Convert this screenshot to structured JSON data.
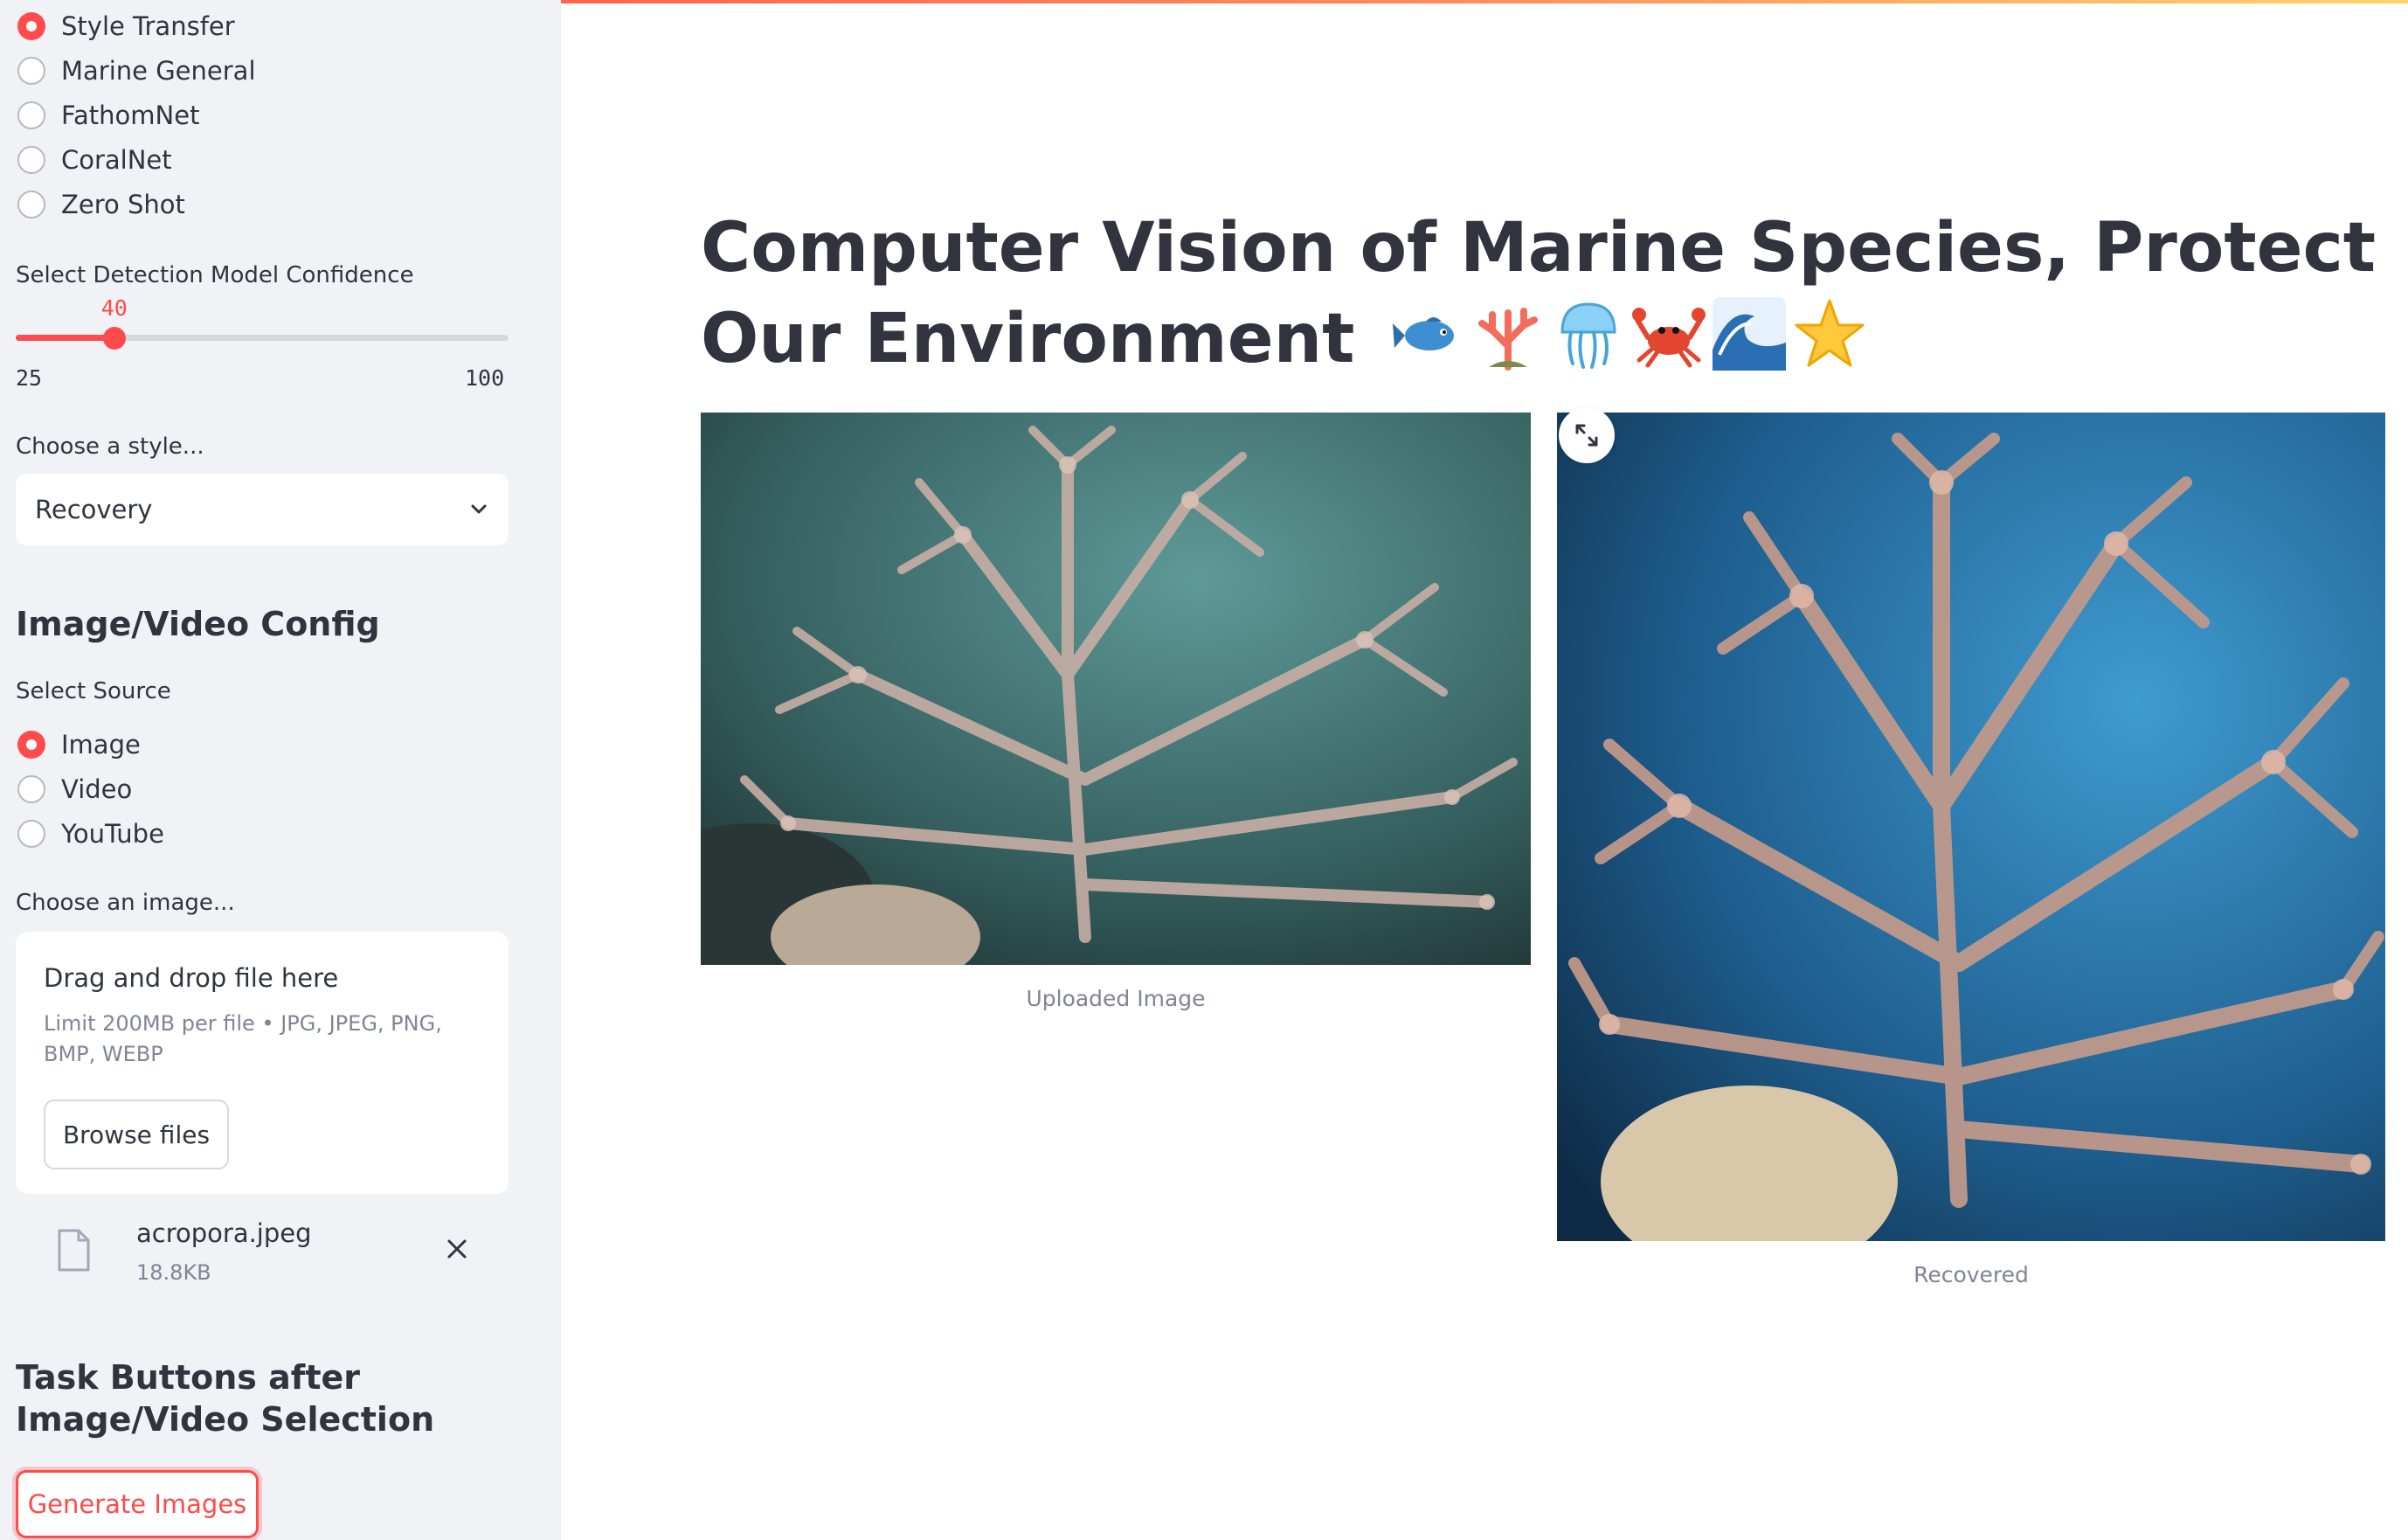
{
  "model_radio": {
    "options": [
      "Style Transfer",
      "Marine General",
      "FathomNet",
      "CoralNet",
      "Zero Shot"
    ],
    "selected": "Style Transfer"
  },
  "confidence_slider": {
    "label": "Select Detection Model Confidence",
    "value": "40",
    "min": "25",
    "max": "100",
    "fraction": 0.2
  },
  "style_select": {
    "label": "Choose a style...",
    "value": "Recovery"
  },
  "image_video_config": {
    "title": "Image/Video Config",
    "source_label": "Select Source",
    "sources": [
      "Image",
      "Video",
      "YouTube"
    ],
    "selected_source": "Image"
  },
  "uploader": {
    "label": "Choose an image...",
    "title": "Drag and drop file here",
    "hint": "Limit 200MB per file • JPG, JPEG, PNG, BMP, WEBP",
    "browse_label": "Browse files",
    "file_name": "acropora.jpeg",
    "file_size": "18.8KB"
  },
  "tasks": {
    "title": "Task Buttons after Image/Video Selection",
    "generate_label": "Generate Images"
  },
  "main": {
    "title": "Computer Vision of Marine Species, Protect Our Environment",
    "emojis": [
      "fish-icon",
      "coral-icon",
      "jellyfish-icon",
      "crab-icon",
      "wave-icon",
      "star-icon"
    ],
    "uploaded_caption": "Uploaded Image",
    "recovered_caption": "Recovered"
  },
  "colors": {
    "accent": "#ff4b4b",
    "sidebar_bg": "#f0f2f6",
    "text": "#31333f",
    "muted": "#808495"
  }
}
